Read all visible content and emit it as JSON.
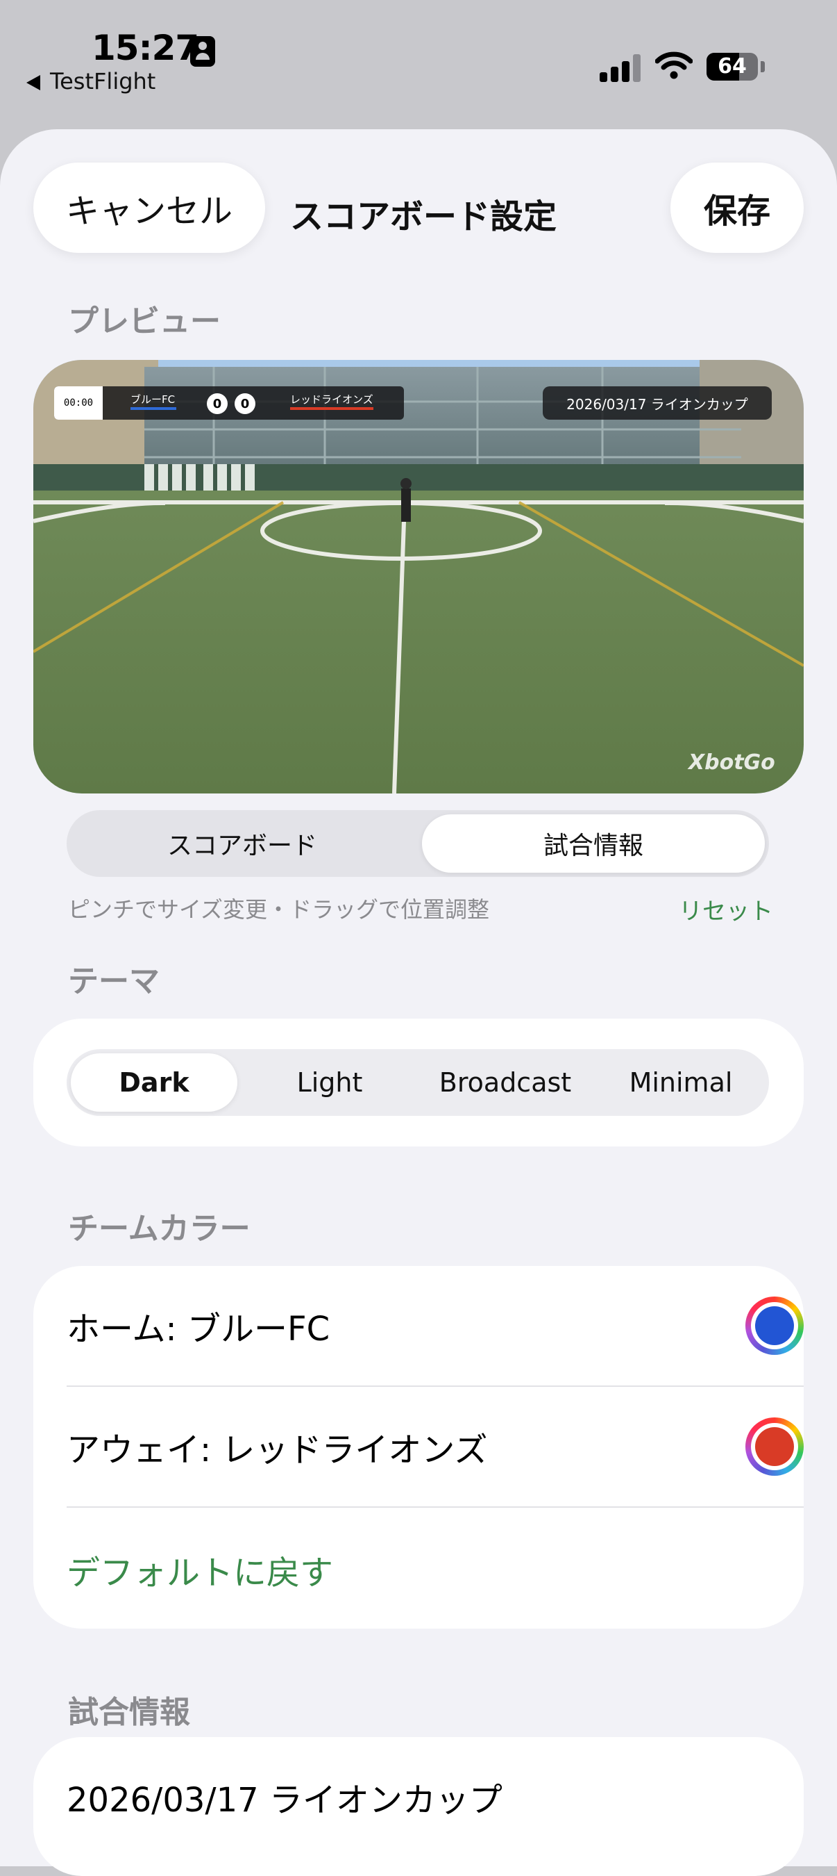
{
  "status_bar": {
    "time": "15:27",
    "back_app": "TestFlight",
    "battery": "64",
    "battery_level": 0.64
  },
  "header": {
    "cancel_label": "キャンセル",
    "title": "スコアボード設定",
    "save_label": "保存"
  },
  "preview": {
    "section_title": "プレビュー",
    "scoreboard": {
      "clock": "00:00",
      "home_team": "ブルーFC",
      "home_score": "0",
      "away_score": "0",
      "away_team": "レッドライオンズ"
    },
    "match_info": "2026/03/17 ライオンカップ",
    "watermark": "XbotGo",
    "mode_tabs": [
      "スコアボード",
      "試合情報"
    ],
    "selected_mode": "試合情報",
    "hint": "ピンチでサイズ変更・ドラッグで位置調整",
    "reset_label": "リセット"
  },
  "theme": {
    "section_title": "テーマ",
    "options": [
      "Dark",
      "Light",
      "Broadcast",
      "Minimal"
    ],
    "selected": "Dark"
  },
  "team_colors": {
    "section_title": "チームカラー",
    "home_label": "ホーム: ブルーFC",
    "home_color": "#2255d4",
    "away_label": "アウェイ: レッドライオンズ",
    "away_color": "#d93b26",
    "reset_default_label": "デフォルトに戻す"
  },
  "match_info_section": {
    "section_title": "試合情報",
    "value": "2026/03/17 ライオンカップ"
  },
  "colors": {
    "accent_green": "#3a8a4a",
    "background": "#f2f2f7"
  }
}
